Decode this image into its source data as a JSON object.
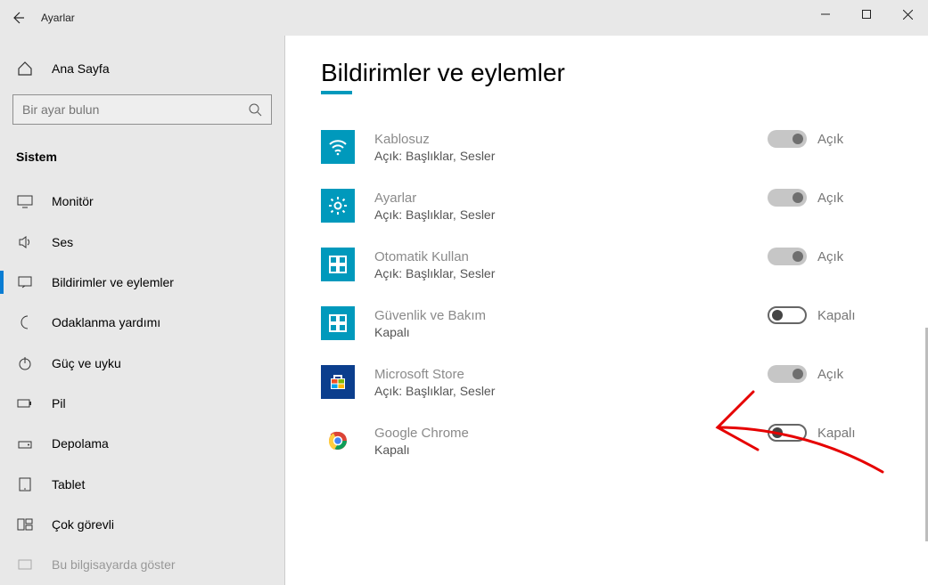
{
  "window": {
    "title": "Ayarlar"
  },
  "sidebar": {
    "home": "Ana Sayfa",
    "search_placeholder": "Bir ayar bulun",
    "group": "Sistem",
    "items": [
      {
        "label": "Monitör"
      },
      {
        "label": "Ses"
      },
      {
        "label": "Bildirimler ve eylemler"
      },
      {
        "label": "Odaklanma yardımı"
      },
      {
        "label": "Güç ve uyku"
      },
      {
        "label": "Pil"
      },
      {
        "label": "Depolama"
      },
      {
        "label": "Tablet"
      },
      {
        "label": "Çok görevli"
      },
      {
        "label": "Bu bilgisayarda göster"
      }
    ]
  },
  "page": {
    "title": "Bildirimler ve eylemler",
    "state_on": "Açık",
    "state_off": "Kapalı",
    "apps": [
      {
        "name": "Kablosuz",
        "sub": "Açık: Başlıklar, Sesler",
        "on": true,
        "icon": "wifi"
      },
      {
        "name": "Ayarlar",
        "sub": "Açık: Başlıklar, Sesler",
        "on": true,
        "icon": "gear"
      },
      {
        "name": "Otomatik Kullan",
        "sub": "Açık: Başlıklar, Sesler",
        "on": true,
        "icon": "grid"
      },
      {
        "name": "Güvenlik ve Bakım",
        "sub": "Kapalı",
        "on": false,
        "icon": "grid"
      },
      {
        "name": "Microsoft Store",
        "sub": "Açık: Başlıklar, Sesler",
        "on": true,
        "icon": "store"
      },
      {
        "name": "Google Chrome",
        "sub": "Kapalı",
        "on": false,
        "icon": "chrome"
      }
    ]
  }
}
